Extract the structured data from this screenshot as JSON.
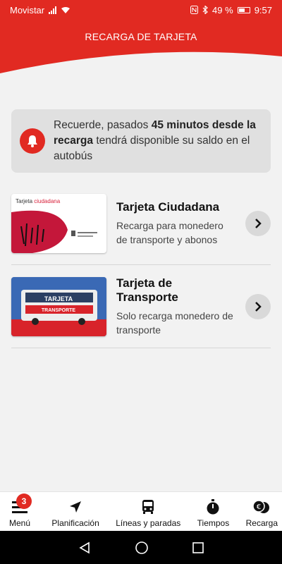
{
  "status": {
    "carrier": "Movistar",
    "battery": "49 %",
    "time": "9:57"
  },
  "header": {
    "title": "RECARGA DE TARJETA"
  },
  "notice": {
    "part1": "Recuerde, pasados ",
    "bold": "45 minutos desde la recarga",
    "part2": " tendrá disponible su saldo en el autobús",
    "icon": "bell-icon"
  },
  "cards": [
    {
      "title": "Tarjeta Ciudadana",
      "subtitle": "Recarga para monedero de transporte y abonos",
      "image_label_1": "Tarjeta",
      "image_label_2": "ciudadana"
    },
    {
      "title": "Tarjeta de Transporte",
      "subtitle": "Solo recarga monedero de transporte",
      "image_label_1": "TARJETA",
      "image_label_2": "TRANSPORTE"
    }
  ],
  "nav": {
    "badge": "3",
    "items": [
      {
        "label": "Menú",
        "icon": "menu-icon"
      },
      {
        "label": "Planificación",
        "icon": "navigation-arrow-icon"
      },
      {
        "label": "Líneas y paradas",
        "icon": "bus-icon"
      },
      {
        "label": "Tiempos",
        "icon": "stopwatch-icon"
      },
      {
        "label": "Recarga",
        "icon": "coins-icon"
      }
    ]
  },
  "colors": {
    "brand_red": "#e12a22",
    "notice_bg": "#e0e0e0"
  }
}
